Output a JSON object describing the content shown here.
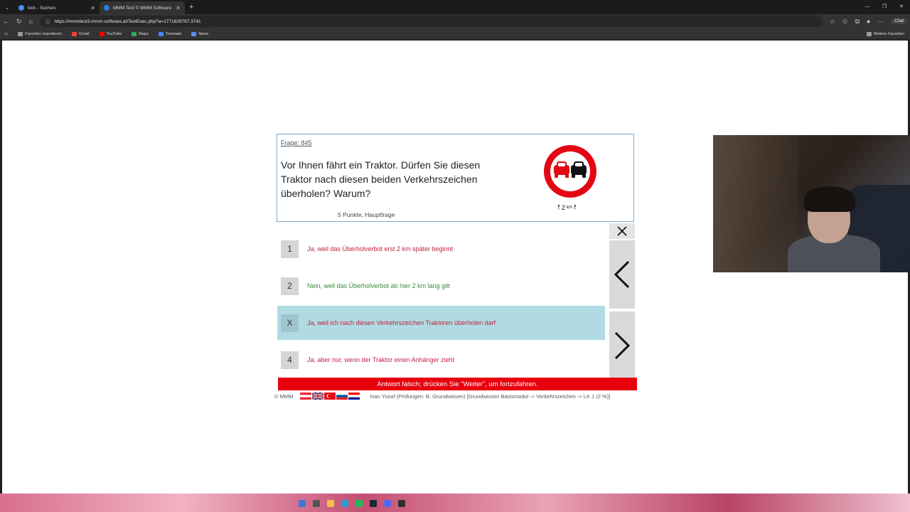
{
  "browser": {
    "tabs": [
      {
        "title": "kick - Suchen",
        "favicon_color": "#4c8bf5",
        "active": false
      },
      {
        "title": "MMM Test © MMM Software 2025",
        "favicon_color": "#2e7dd7",
        "active": true
      }
    ],
    "url": "https://mmmtest3.mmm-software.at/TestExec.php?a=1771829787.3741",
    "chat_label": "Chat",
    "bookmarks": [
      {
        "label": "Favoriten importieren",
        "color": "#9a9a9a"
      },
      {
        "label": "Gmail",
        "color": "#ea4335"
      },
      {
        "label": "YouTube",
        "color": "#ff0000"
      },
      {
        "label": "Maps",
        "color": "#34a853"
      },
      {
        "label": "Translate",
        "color": "#4285f4"
      },
      {
        "label": "News",
        "color": "#5b8def"
      }
    ],
    "more_favorites": "Weitere Favoriten"
  },
  "question": {
    "number": "Frage: 845",
    "text": "Vor Ihnen fährt ein Traktor. Dürfen Sie diesen Traktor nach diesen beiden Verkehrszeichen überholen? Warum?",
    "points": "5 Punkte, Hauptfrage",
    "sign_distance": "2",
    "sign_unit": "km"
  },
  "answers": [
    {
      "marker": "1",
      "label": "Ja, weil das Überholverbot erst 2 km später beginnt",
      "status": "wrong",
      "selected": false
    },
    {
      "marker": "2",
      "label": "Nein, weil das Überholverbot ab hier 2 km lang gilt",
      "status": "right",
      "selected": false
    },
    {
      "marker": "X",
      "label": "Ja, weil ich nach diesen Verkehrszeichen Traktoren überholen darf",
      "status": "wrong",
      "selected": true
    },
    {
      "marker": "4",
      "label": "Ja, aber nur, wenn der Traktor einen Anhänger zieht",
      "status": "wrong",
      "selected": false
    }
  ],
  "status_message": "Antwort falsch; drücken Sie \"Weiter\", um fortzufahren.",
  "footer": {
    "copyright": "© MMM",
    "info": "Inan Yusuf (Prüfungen: B, Grundwissen) [Grundwissen Basismodul -> Verkehrszeichen -> LK 1 (2 %)]"
  },
  "colors": {
    "error_red": "#e8000d",
    "selected_bg": "#b0dbe2",
    "wrong_text": "#c32040",
    "right_text": "#3a8a3a"
  }
}
